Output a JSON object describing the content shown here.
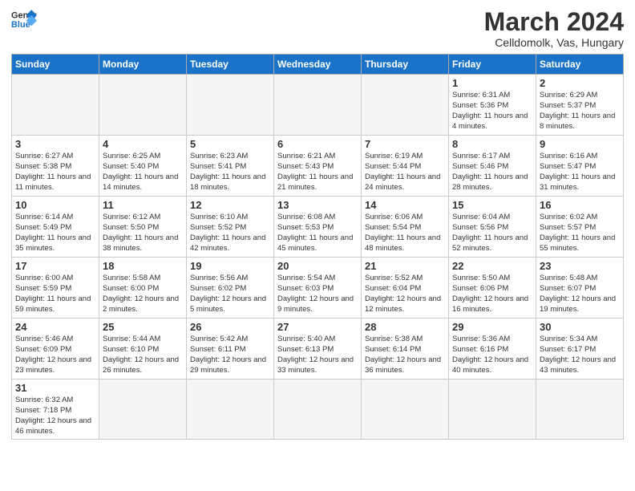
{
  "logo": {
    "text_general": "General",
    "text_blue": "Blue"
  },
  "header": {
    "month_year": "March 2024",
    "location": "Celldomolk, Vas, Hungary"
  },
  "weekdays": [
    "Sunday",
    "Monday",
    "Tuesday",
    "Wednesday",
    "Thursday",
    "Friday",
    "Saturday"
  ],
  "weeks": [
    [
      {
        "day": "",
        "info": "",
        "empty": true
      },
      {
        "day": "",
        "info": "",
        "empty": true
      },
      {
        "day": "",
        "info": "",
        "empty": true
      },
      {
        "day": "",
        "info": "",
        "empty": true
      },
      {
        "day": "",
        "info": "",
        "empty": true
      },
      {
        "day": "1",
        "info": "Sunrise: 6:31 AM\nSunset: 5:36 PM\nDaylight: 11 hours\nand 4 minutes."
      },
      {
        "day": "2",
        "info": "Sunrise: 6:29 AM\nSunset: 5:37 PM\nDaylight: 11 hours\nand 8 minutes."
      }
    ],
    [
      {
        "day": "3",
        "info": "Sunrise: 6:27 AM\nSunset: 5:38 PM\nDaylight: 11 hours\nand 11 minutes."
      },
      {
        "day": "4",
        "info": "Sunrise: 6:25 AM\nSunset: 5:40 PM\nDaylight: 11 hours\nand 14 minutes."
      },
      {
        "day": "5",
        "info": "Sunrise: 6:23 AM\nSunset: 5:41 PM\nDaylight: 11 hours\nand 18 minutes."
      },
      {
        "day": "6",
        "info": "Sunrise: 6:21 AM\nSunset: 5:43 PM\nDaylight: 11 hours\nand 21 minutes."
      },
      {
        "day": "7",
        "info": "Sunrise: 6:19 AM\nSunset: 5:44 PM\nDaylight: 11 hours\nand 24 minutes."
      },
      {
        "day": "8",
        "info": "Sunrise: 6:17 AM\nSunset: 5:46 PM\nDaylight: 11 hours\nand 28 minutes."
      },
      {
        "day": "9",
        "info": "Sunrise: 6:16 AM\nSunset: 5:47 PM\nDaylight: 11 hours\nand 31 minutes."
      }
    ],
    [
      {
        "day": "10",
        "info": "Sunrise: 6:14 AM\nSunset: 5:49 PM\nDaylight: 11 hours\nand 35 minutes."
      },
      {
        "day": "11",
        "info": "Sunrise: 6:12 AM\nSunset: 5:50 PM\nDaylight: 11 hours\nand 38 minutes."
      },
      {
        "day": "12",
        "info": "Sunrise: 6:10 AM\nSunset: 5:52 PM\nDaylight: 11 hours\nand 42 minutes."
      },
      {
        "day": "13",
        "info": "Sunrise: 6:08 AM\nSunset: 5:53 PM\nDaylight: 11 hours\nand 45 minutes."
      },
      {
        "day": "14",
        "info": "Sunrise: 6:06 AM\nSunset: 5:54 PM\nDaylight: 11 hours\nand 48 minutes."
      },
      {
        "day": "15",
        "info": "Sunrise: 6:04 AM\nSunset: 5:56 PM\nDaylight: 11 hours\nand 52 minutes."
      },
      {
        "day": "16",
        "info": "Sunrise: 6:02 AM\nSunset: 5:57 PM\nDaylight: 11 hours\nand 55 minutes."
      }
    ],
    [
      {
        "day": "17",
        "info": "Sunrise: 6:00 AM\nSunset: 5:59 PM\nDaylight: 11 hours\nand 59 minutes."
      },
      {
        "day": "18",
        "info": "Sunrise: 5:58 AM\nSunset: 6:00 PM\nDaylight: 12 hours\nand 2 minutes."
      },
      {
        "day": "19",
        "info": "Sunrise: 5:56 AM\nSunset: 6:02 PM\nDaylight: 12 hours\nand 5 minutes."
      },
      {
        "day": "20",
        "info": "Sunrise: 5:54 AM\nSunset: 6:03 PM\nDaylight: 12 hours\nand 9 minutes."
      },
      {
        "day": "21",
        "info": "Sunrise: 5:52 AM\nSunset: 6:04 PM\nDaylight: 12 hours\nand 12 minutes."
      },
      {
        "day": "22",
        "info": "Sunrise: 5:50 AM\nSunset: 6:06 PM\nDaylight: 12 hours\nand 16 minutes."
      },
      {
        "day": "23",
        "info": "Sunrise: 5:48 AM\nSunset: 6:07 PM\nDaylight: 12 hours\nand 19 minutes."
      }
    ],
    [
      {
        "day": "24",
        "info": "Sunrise: 5:46 AM\nSunset: 6:09 PM\nDaylight: 12 hours\nand 23 minutes."
      },
      {
        "day": "25",
        "info": "Sunrise: 5:44 AM\nSunset: 6:10 PM\nDaylight: 12 hours\nand 26 minutes."
      },
      {
        "day": "26",
        "info": "Sunrise: 5:42 AM\nSunset: 6:11 PM\nDaylight: 12 hours\nand 29 minutes."
      },
      {
        "day": "27",
        "info": "Sunrise: 5:40 AM\nSunset: 6:13 PM\nDaylight: 12 hours\nand 33 minutes."
      },
      {
        "day": "28",
        "info": "Sunrise: 5:38 AM\nSunset: 6:14 PM\nDaylight: 12 hours\nand 36 minutes."
      },
      {
        "day": "29",
        "info": "Sunrise: 5:36 AM\nSunset: 6:16 PM\nDaylight: 12 hours\nand 40 minutes."
      },
      {
        "day": "30",
        "info": "Sunrise: 5:34 AM\nSunset: 6:17 PM\nDaylight: 12 hours\nand 43 minutes."
      }
    ],
    [
      {
        "day": "31",
        "info": "Sunrise: 6:32 AM\nSunset: 7:18 PM\nDaylight: 12 hours\nand 46 minutes."
      },
      {
        "day": "",
        "info": "",
        "empty": true
      },
      {
        "day": "",
        "info": "",
        "empty": true
      },
      {
        "day": "",
        "info": "",
        "empty": true
      },
      {
        "day": "",
        "info": "",
        "empty": true
      },
      {
        "day": "",
        "info": "",
        "empty": true
      },
      {
        "day": "",
        "info": "",
        "empty": true
      }
    ]
  ]
}
